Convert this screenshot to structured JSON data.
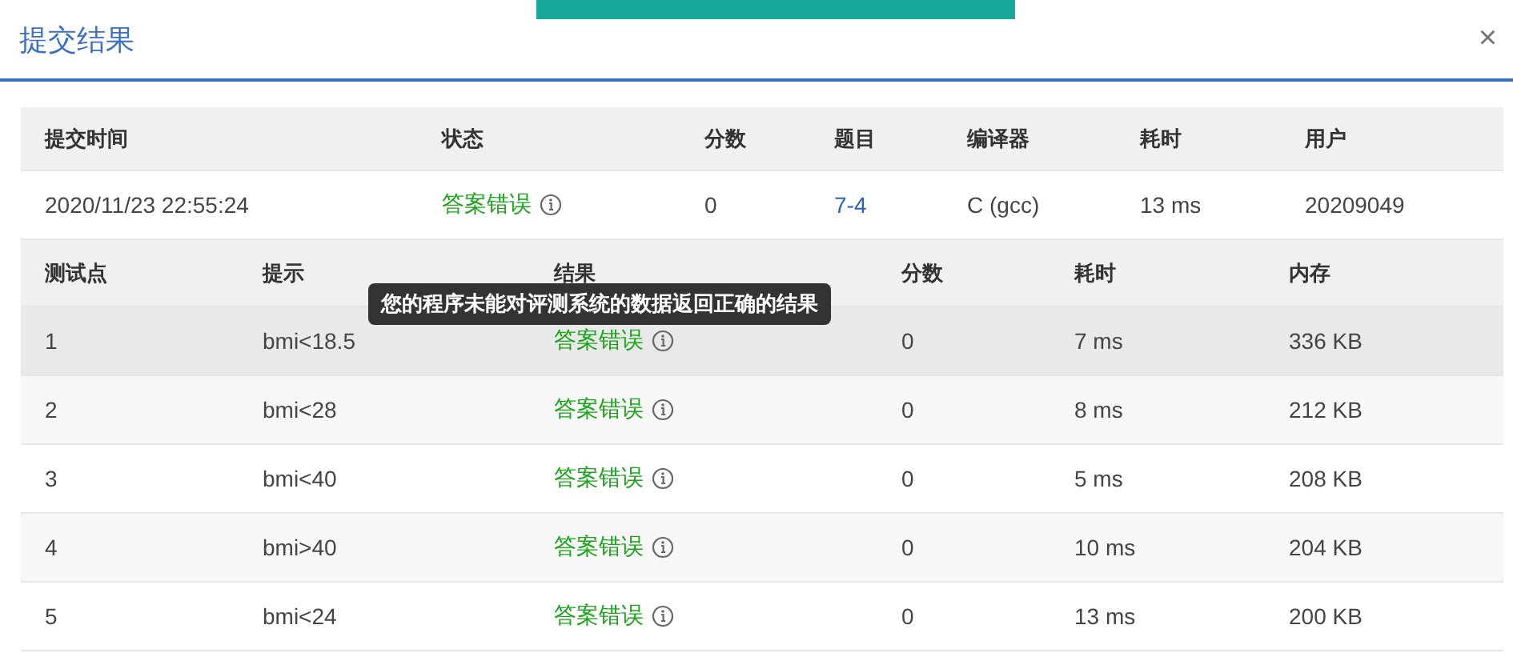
{
  "dialog": {
    "title": "提交结果",
    "close": "×"
  },
  "submission": {
    "columns": [
      "提交时间",
      "状态",
      "分数",
      "题目",
      "编译器",
      "耗时",
      "用户"
    ],
    "row": {
      "time": "2020/11/23 22:55:24",
      "status": "答案错误",
      "score": "0",
      "problem": "7-4",
      "compiler": "C (gcc)",
      "duration": "13 ms",
      "user": "20209049"
    }
  },
  "cases": {
    "columns": [
      "测试点",
      "提示",
      "结果",
      "分数",
      "耗时",
      "内存"
    ],
    "rows": [
      {
        "case": "1",
        "hint": "bmi<18.5",
        "result": "答案错误",
        "score": "0",
        "duration": "7 ms",
        "memory": "336 KB",
        "hovered": true
      },
      {
        "case": "2",
        "hint": "bmi<28",
        "result": "答案错误",
        "score": "0",
        "duration": "8 ms",
        "memory": "212 KB",
        "hovered": false
      },
      {
        "case": "3",
        "hint": "bmi<40",
        "result": "答案错误",
        "score": "0",
        "duration": "5 ms",
        "memory": "208 KB",
        "hovered": false
      },
      {
        "case": "4",
        "hint": "bmi>40",
        "result": "答案错误",
        "score": "0",
        "duration": "10 ms",
        "memory": "204 KB",
        "hovered": false
      },
      {
        "case": "5",
        "hint": "bmi<24",
        "result": "答案错误",
        "score": "0",
        "duration": "13 ms",
        "memory": "200 KB",
        "hovered": false
      }
    ]
  },
  "tooltip": "您的程序未能对评测系统的数据返回正确的结果"
}
